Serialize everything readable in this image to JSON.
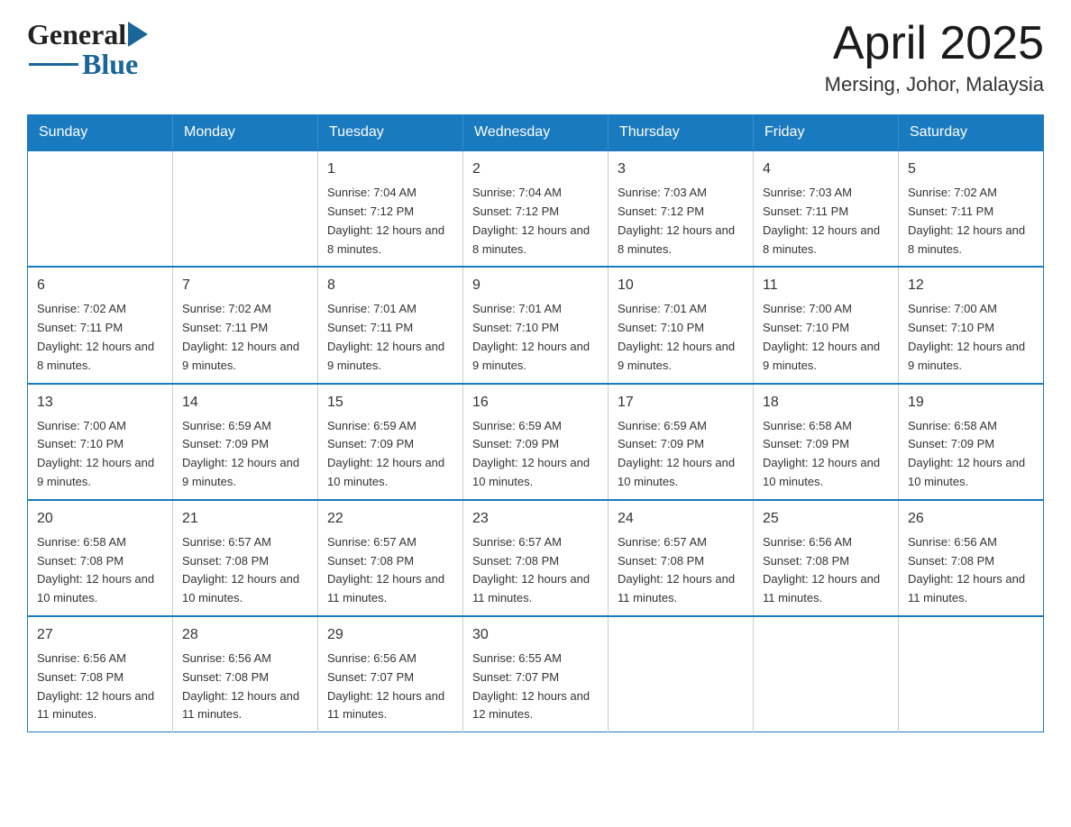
{
  "logo": {
    "general": "General",
    "blue": "Blue",
    "arrow": "▶"
  },
  "title": "April 2025",
  "subtitle": "Mersing, Johor, Malaysia",
  "days_of_week": [
    "Sunday",
    "Monday",
    "Tuesday",
    "Wednesday",
    "Thursday",
    "Friday",
    "Saturday"
  ],
  "weeks": [
    [
      {
        "day": "",
        "sunrise": "",
        "sunset": "",
        "daylight": ""
      },
      {
        "day": "",
        "sunrise": "",
        "sunset": "",
        "daylight": ""
      },
      {
        "day": "1",
        "sunrise": "Sunrise: 7:04 AM",
        "sunset": "Sunset: 7:12 PM",
        "daylight": "Daylight: 12 hours and 8 minutes."
      },
      {
        "day": "2",
        "sunrise": "Sunrise: 7:04 AM",
        "sunset": "Sunset: 7:12 PM",
        "daylight": "Daylight: 12 hours and 8 minutes."
      },
      {
        "day": "3",
        "sunrise": "Sunrise: 7:03 AM",
        "sunset": "Sunset: 7:12 PM",
        "daylight": "Daylight: 12 hours and 8 minutes."
      },
      {
        "day": "4",
        "sunrise": "Sunrise: 7:03 AM",
        "sunset": "Sunset: 7:11 PM",
        "daylight": "Daylight: 12 hours and 8 minutes."
      },
      {
        "day": "5",
        "sunrise": "Sunrise: 7:02 AM",
        "sunset": "Sunset: 7:11 PM",
        "daylight": "Daylight: 12 hours and 8 minutes."
      }
    ],
    [
      {
        "day": "6",
        "sunrise": "Sunrise: 7:02 AM",
        "sunset": "Sunset: 7:11 PM",
        "daylight": "Daylight: 12 hours and 8 minutes."
      },
      {
        "day": "7",
        "sunrise": "Sunrise: 7:02 AM",
        "sunset": "Sunset: 7:11 PM",
        "daylight": "Daylight: 12 hours and 9 minutes."
      },
      {
        "day": "8",
        "sunrise": "Sunrise: 7:01 AM",
        "sunset": "Sunset: 7:11 PM",
        "daylight": "Daylight: 12 hours and 9 minutes."
      },
      {
        "day": "9",
        "sunrise": "Sunrise: 7:01 AM",
        "sunset": "Sunset: 7:10 PM",
        "daylight": "Daylight: 12 hours and 9 minutes."
      },
      {
        "day": "10",
        "sunrise": "Sunrise: 7:01 AM",
        "sunset": "Sunset: 7:10 PM",
        "daylight": "Daylight: 12 hours and 9 minutes."
      },
      {
        "day": "11",
        "sunrise": "Sunrise: 7:00 AM",
        "sunset": "Sunset: 7:10 PM",
        "daylight": "Daylight: 12 hours and 9 minutes."
      },
      {
        "day": "12",
        "sunrise": "Sunrise: 7:00 AM",
        "sunset": "Sunset: 7:10 PM",
        "daylight": "Daylight: 12 hours and 9 minutes."
      }
    ],
    [
      {
        "day": "13",
        "sunrise": "Sunrise: 7:00 AM",
        "sunset": "Sunset: 7:10 PM",
        "daylight": "Daylight: 12 hours and 9 minutes."
      },
      {
        "day": "14",
        "sunrise": "Sunrise: 6:59 AM",
        "sunset": "Sunset: 7:09 PM",
        "daylight": "Daylight: 12 hours and 9 minutes."
      },
      {
        "day": "15",
        "sunrise": "Sunrise: 6:59 AM",
        "sunset": "Sunset: 7:09 PM",
        "daylight": "Daylight: 12 hours and 10 minutes."
      },
      {
        "day": "16",
        "sunrise": "Sunrise: 6:59 AM",
        "sunset": "Sunset: 7:09 PM",
        "daylight": "Daylight: 12 hours and 10 minutes."
      },
      {
        "day": "17",
        "sunrise": "Sunrise: 6:59 AM",
        "sunset": "Sunset: 7:09 PM",
        "daylight": "Daylight: 12 hours and 10 minutes."
      },
      {
        "day": "18",
        "sunrise": "Sunrise: 6:58 AM",
        "sunset": "Sunset: 7:09 PM",
        "daylight": "Daylight: 12 hours and 10 minutes."
      },
      {
        "day": "19",
        "sunrise": "Sunrise: 6:58 AM",
        "sunset": "Sunset: 7:09 PM",
        "daylight": "Daylight: 12 hours and 10 minutes."
      }
    ],
    [
      {
        "day": "20",
        "sunrise": "Sunrise: 6:58 AM",
        "sunset": "Sunset: 7:08 PM",
        "daylight": "Daylight: 12 hours and 10 minutes."
      },
      {
        "day": "21",
        "sunrise": "Sunrise: 6:57 AM",
        "sunset": "Sunset: 7:08 PM",
        "daylight": "Daylight: 12 hours and 10 minutes."
      },
      {
        "day": "22",
        "sunrise": "Sunrise: 6:57 AM",
        "sunset": "Sunset: 7:08 PM",
        "daylight": "Daylight: 12 hours and 11 minutes."
      },
      {
        "day": "23",
        "sunrise": "Sunrise: 6:57 AM",
        "sunset": "Sunset: 7:08 PM",
        "daylight": "Daylight: 12 hours and 11 minutes."
      },
      {
        "day": "24",
        "sunrise": "Sunrise: 6:57 AM",
        "sunset": "Sunset: 7:08 PM",
        "daylight": "Daylight: 12 hours and 11 minutes."
      },
      {
        "day": "25",
        "sunrise": "Sunrise: 6:56 AM",
        "sunset": "Sunset: 7:08 PM",
        "daylight": "Daylight: 12 hours and 11 minutes."
      },
      {
        "day": "26",
        "sunrise": "Sunrise: 6:56 AM",
        "sunset": "Sunset: 7:08 PM",
        "daylight": "Daylight: 12 hours and 11 minutes."
      }
    ],
    [
      {
        "day": "27",
        "sunrise": "Sunrise: 6:56 AM",
        "sunset": "Sunset: 7:08 PM",
        "daylight": "Daylight: 12 hours and 11 minutes."
      },
      {
        "day": "28",
        "sunrise": "Sunrise: 6:56 AM",
        "sunset": "Sunset: 7:08 PM",
        "daylight": "Daylight: 12 hours and 11 minutes."
      },
      {
        "day": "29",
        "sunrise": "Sunrise: 6:56 AM",
        "sunset": "Sunset: 7:07 PM",
        "daylight": "Daylight: 12 hours and 11 minutes."
      },
      {
        "day": "30",
        "sunrise": "Sunrise: 6:55 AM",
        "sunset": "Sunset: 7:07 PM",
        "daylight": "Daylight: 12 hours and 12 minutes."
      },
      {
        "day": "",
        "sunrise": "",
        "sunset": "",
        "daylight": ""
      },
      {
        "day": "",
        "sunrise": "",
        "sunset": "",
        "daylight": ""
      },
      {
        "day": "",
        "sunrise": "",
        "sunset": "",
        "daylight": ""
      }
    ]
  ]
}
